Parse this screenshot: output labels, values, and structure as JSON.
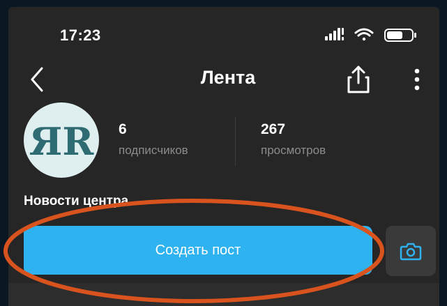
{
  "status_bar": {
    "time": "17:23",
    "icons": [
      "cellular-signal-icon",
      "wifi-icon",
      "battery-icon"
    ]
  },
  "nav": {
    "back_icon": "chevron-left-icon",
    "title": "Лента",
    "share_icon": "share-icon",
    "more_icon": "more-vertical-icon"
  },
  "profile": {
    "avatar_text": "ЯR",
    "followers": {
      "value": "6",
      "label": "подписчиков"
    },
    "views": {
      "value": "267",
      "label": "просмотров"
    },
    "channel_name": "Новости центра"
  },
  "actions": {
    "create_post_label": "Создать пост",
    "camera_icon": "camera-icon"
  },
  "colors": {
    "background": "#262626",
    "accent": "#2fb2f0",
    "highlight": "#d9531e",
    "muted_text": "#8c8c8c",
    "outer_border": "#0c1724"
  }
}
